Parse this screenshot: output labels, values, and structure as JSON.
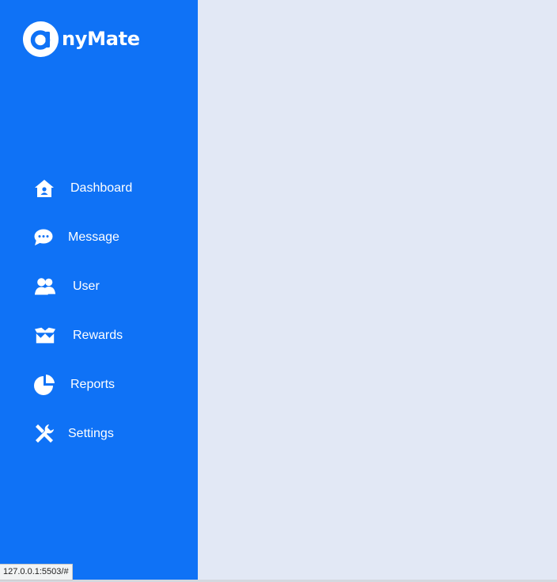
{
  "brand": {
    "logo_letter": "a",
    "name": "nyMate"
  },
  "nav": {
    "items": [
      {
        "label": "Dashboard",
        "icon": "home-icon"
      },
      {
        "label": "Message",
        "icon": "chat-bubble-icon"
      },
      {
        "label": "User",
        "icon": "users-icon"
      },
      {
        "label": "Rewards",
        "icon": "box-icon"
      },
      {
        "label": "Reports",
        "icon": "pie-chart-icon"
      },
      {
        "label": "Settings",
        "icon": "tools-icon"
      }
    ]
  },
  "status_bar": {
    "url": "127.0.0.1:5503/#"
  },
  "colors": {
    "sidebar": "#0f72f6",
    "main_background": "#e2e8f5",
    "text_on_sidebar": "#ffffff"
  }
}
